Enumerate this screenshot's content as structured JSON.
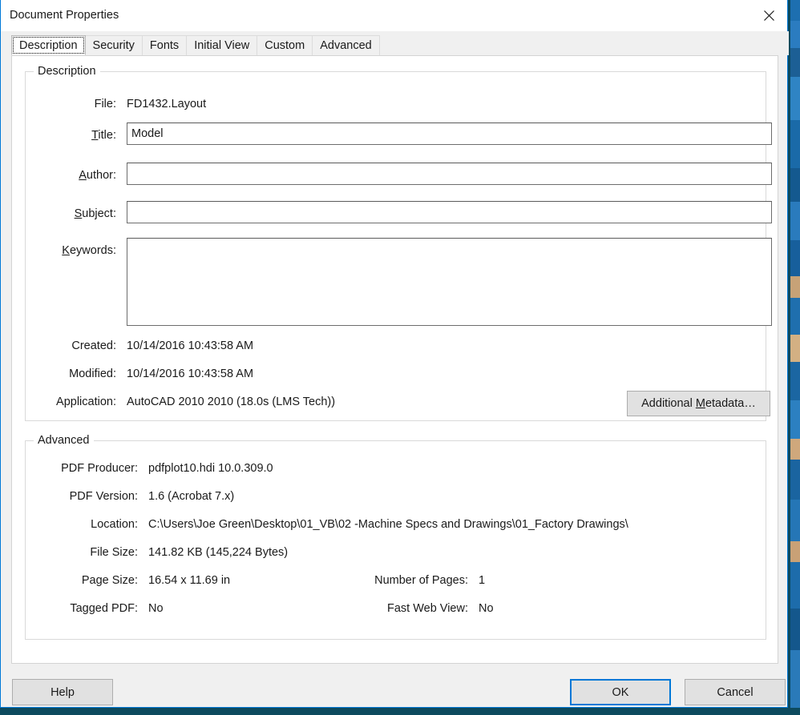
{
  "window": {
    "title": "Document Properties",
    "close_icon": "close-icon"
  },
  "tabs": [
    {
      "label": "Description",
      "selected": true
    },
    {
      "label": "Security",
      "selected": false
    },
    {
      "label": "Fonts",
      "selected": false
    },
    {
      "label": "Initial View",
      "selected": false
    },
    {
      "label": "Custom",
      "selected": false
    },
    {
      "label": "Advanced",
      "selected": false
    }
  ],
  "description": {
    "legend": "Description",
    "file_label": "File:",
    "file_value": "FD1432.Layout",
    "title_label": "Title:",
    "title_mnemonic": "T",
    "title_value": "Model",
    "author_label": "Author:",
    "author_mnemonic": "A",
    "author_value": "",
    "subject_label": "Subject:",
    "subject_mnemonic": "S",
    "subject_value": "",
    "keywords_label": "Keywords:",
    "keywords_mnemonic": "K",
    "keywords_value": "",
    "created_label": "Created:",
    "created_value": "10/14/2016 10:43:58 AM",
    "modified_label": "Modified:",
    "modified_value": "10/14/2016 10:43:58 AM",
    "application_label": "Application:",
    "application_value": "AutoCAD 2010 2010 (18.0s (LMS Tech))",
    "additional_metadata_label": "Additional Metadata…",
    "additional_metadata_mnemonic": "M"
  },
  "advanced": {
    "legend": "Advanced",
    "producer_label": "PDF Producer:",
    "producer_value": "pdfplot10.hdi 10.0.309.0",
    "version_label": "PDF Version:",
    "version_value": "1.6 (Acrobat 7.x)",
    "location_label": "Location:",
    "location_value": "C:\\Users\\Joe Green\\Desktop\\01_VB\\02 -Machine Specs and Drawings\\01_Factory Drawings\\",
    "filesize_label": "File Size:",
    "filesize_value": "141.82 KB (145,224 Bytes)",
    "pagesize_label": "Page Size:",
    "pagesize_value": "16.54 x 11.69 in",
    "tagged_label": "Tagged PDF:",
    "tagged_value": "No",
    "numpages_label": "Number of Pages:",
    "numpages_value": "1",
    "fastweb_label": "Fast Web View:",
    "fastweb_value": "No"
  },
  "footer": {
    "help_label": "Help",
    "ok_label": "OK",
    "cancel_label": "Cancel"
  },
  "colors": {
    "accent": "#0078d7",
    "dialog_face": "#f0f0f0",
    "page": "#ffffff",
    "taskbar": "#0d4a5e",
    "button_face": "#e1e1e1"
  }
}
